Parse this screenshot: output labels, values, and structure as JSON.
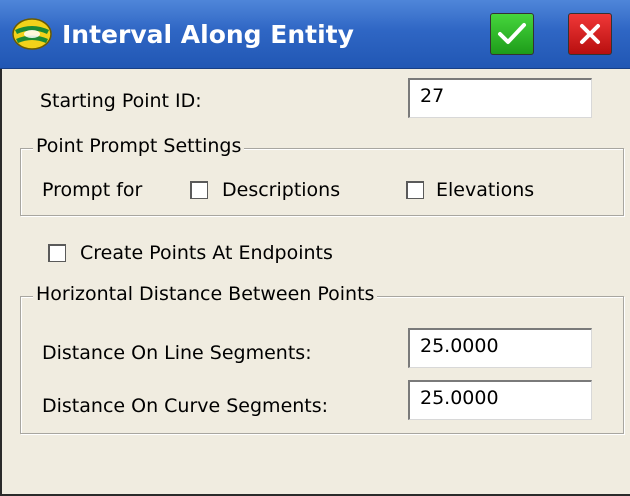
{
  "window": {
    "title": "Interval Along Entity",
    "ok_icon": "checkmark-icon",
    "cancel_icon": "close-icon",
    "ok_color": "#2fb82a",
    "cancel_color": "#d81e1e",
    "titlebar_color": "#2f66c4"
  },
  "starting_point": {
    "label": "Starting Point ID:",
    "value": "27"
  },
  "point_prompt": {
    "legend": "Point Prompt Settings",
    "prompt_for_label": "Prompt for",
    "descriptions": {
      "label": "Descriptions",
      "checked": false
    },
    "elevations": {
      "label": "Elevations",
      "checked": false
    }
  },
  "create_points": {
    "label": "Create Points At Endpoints",
    "checked": false
  },
  "horizontal_distance": {
    "legend": "Horizontal Distance Between Points",
    "line_segments": {
      "label": "Distance On Line Segments:",
      "value": "25.0000"
    },
    "curve_segments": {
      "label": "Distance On Curve Segments:",
      "value": "25.0000"
    }
  }
}
